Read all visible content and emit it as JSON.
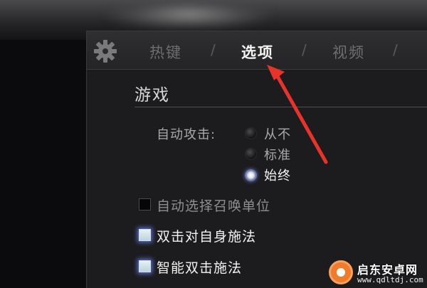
{
  "tabs": [
    {
      "label": "热键",
      "active": false
    },
    {
      "label": "选项",
      "active": true
    },
    {
      "label": "视频",
      "active": false
    }
  ],
  "tab_separator": "/",
  "section": {
    "title": "游戏"
  },
  "auto_attack": {
    "label": "自动攻击:",
    "options": [
      {
        "label": "从不",
        "checked": false
      },
      {
        "label": "标准",
        "checked": false
      },
      {
        "label": "始终",
        "checked": true
      }
    ]
  },
  "checkboxes": [
    {
      "label": "自动选择召唤单位",
      "checked": false
    },
    {
      "label": "双击对自身施法",
      "checked": true
    },
    {
      "label": "智能双击施法",
      "checked": true
    }
  ],
  "watermark": {
    "name": "启东安卓网",
    "url": "www.qdltdj.com"
  },
  "colors": {
    "accent_glow": "#5d6ed2",
    "annotation_arrow": "#e8322a",
    "watermark_orange": "#f07b2a"
  },
  "icons": {
    "settings": "gear-icon"
  }
}
